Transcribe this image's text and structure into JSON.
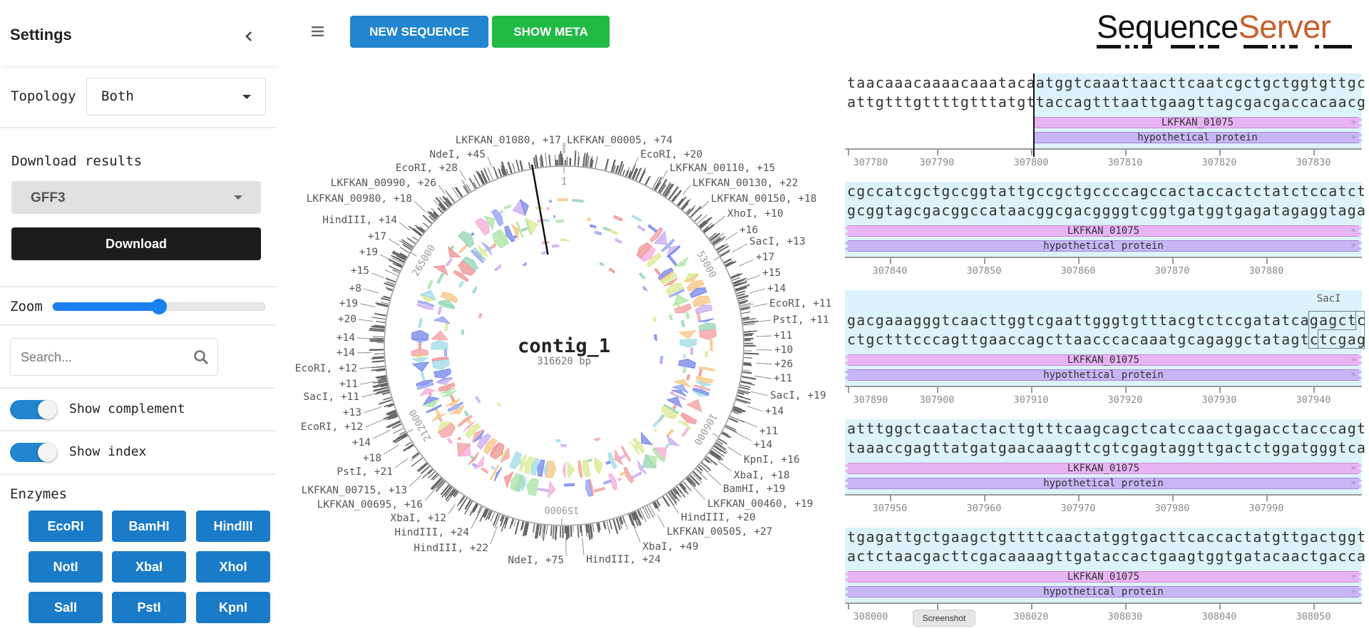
{
  "sidebar": {
    "title": "Settings",
    "collapse_icon": "chevron-left-icon",
    "topology": {
      "label": "Topology",
      "value": "Both"
    },
    "download": {
      "label": "Download results",
      "format": "GFF3",
      "button": "Download"
    },
    "zoom": {
      "label": "Zoom",
      "value": 0.5
    },
    "search": {
      "placeholder": "Search...",
      "icon": "search-icon"
    },
    "toggles": [
      {
        "label": "Show complement",
        "on": true
      },
      {
        "label": "Show index",
        "on": true
      }
    ],
    "enzymes": {
      "label": "Enzymes",
      "buttons": [
        "EcoRI",
        "BamHI",
        "HindIII",
        "NotI",
        "XbaI",
        "XhoI",
        "SalI",
        "PstI",
        "KpnI"
      ]
    }
  },
  "toolbar": {
    "menu_icon": "hamburger-icon",
    "new_sequence": "NEW SEQUENCE",
    "show_meta": "SHOW META"
  },
  "logo": {
    "part1": "Sequence",
    "part2": "Server"
  },
  "map": {
    "name": "contig_1",
    "length": "316620 bp",
    "index_labels": [
      "1",
      "53000",
      "106000",
      "159000",
      "212000",
      "265000"
    ],
    "labels_left": [
      "LKFKAN_01080, +17",
      "NdeI, +45",
      "EcoRI, +28",
      "LKFKAN_00990, +26",
      "LKFKAN_00980, +18",
      "HindIII, +14",
      "+17",
      "+19",
      "+15",
      "+8",
      "+19",
      "+20",
      "+14",
      "+14",
      "EcoRI, +12",
      "+11",
      "SacI, +11",
      "+13",
      "EcoRI, +12",
      "+14",
      "+18",
      "PstI, +21",
      "LKFKAN_00715, +13",
      "LKFKAN_00695, +16",
      "XbaI, +12",
      "HindIII, +24",
      "HindIII, +22",
      "NdeI, +75"
    ],
    "labels_right": [
      "LKFKAN_00005, +74",
      "EcoRI, +20",
      "LKFKAN_00110, +15",
      "LKFKAN_00130, +22",
      "LKFKAN_00150, +18",
      "XhoI, +10",
      "+16",
      "SacI, +13",
      "+17",
      "+15",
      "+14",
      "EcoRI, +11",
      "PstI, +11",
      "+11",
      "+10",
      "+26",
      "+11",
      "SacI, +19",
      "+14",
      "+11",
      "+14",
      "KpnI, +16",
      "XbaI, +18",
      "BamHI, +19",
      "LKFKAN_00460, +19",
      "HindIII, +20",
      "LKFKAN_00505, +27",
      "XbaI, +49",
      "HindIII, +24"
    ]
  },
  "viewer": {
    "feature": {
      "name": "LKFKAN_01075",
      "product": "hypothetical protein",
      "start": 307800
    },
    "blocks": [
      {
        "start": 307780,
        "top": "taacaaacaaaacaaatacaatggtcaaattaacttcaatcgctgctggtgttgc",
        "bottom": "attgtttgttttgtttatgttaccagtttaattgaagttagcgacgaccacaacg",
        "ticks": [
          "307780",
          "307790",
          "307800",
          "307810",
          "307820",
          "307830"
        ]
      },
      {
        "start": 307835,
        "top": "cgccatcgctgccggtattgccgctgccccagccactaccactctatctccatct",
        "bottom": "gcggtagcgacggccataacggcgacggggtcggtgatggtgagatagaggtaga",
        "ticks": [
          "307840",
          "307850",
          "307860",
          "307870",
          "307880"
        ]
      },
      {
        "start": 307890,
        "top": "gacgaaagggtcaacttggtcgaattgggtgtttacgtctccgatatcagagctc",
        "bottom": "ctgctttcccagttgaaccagcttaacccacaaatgcagaggctatagtctcgag",
        "ticks": [
          "307890",
          "307900",
          "307910",
          "307920",
          "307930",
          "307940"
        ],
        "enzyme": "SacI"
      },
      {
        "start": 307945,
        "top": "atttggctcaatactacttgtttcaagcagctcatccaactgagacctacccagt",
        "bottom": "taaaccgagttatgatgaacaaagttcgtcgagtaggttgactctggatgggtca",
        "ticks": [
          "307950",
          "307960",
          "307970",
          "307980",
          "307990"
        ]
      },
      {
        "start": 308000,
        "top": "tgagattgctgaagctgttttcaactatggtgacttcaccactatgttgactggt",
        "bottom": "actctaacgacttcgacaaaagttgataccactgaagtggtgatacaactgacca",
        "ticks": [
          "308000",
          "308010",
          "308020",
          "308030",
          "308040",
          "308050"
        ]
      }
    ]
  },
  "tooltip": "Screenshot",
  "colors": {
    "primary": "#2185d0",
    "green": "#21ba45",
    "dark": "#1b1c1d",
    "logo_accent": "#c8602a",
    "feature_pink": "#e9b4f4",
    "feature_purple": "#c9b6f6",
    "sequence_bg": "#ddf3fb"
  }
}
